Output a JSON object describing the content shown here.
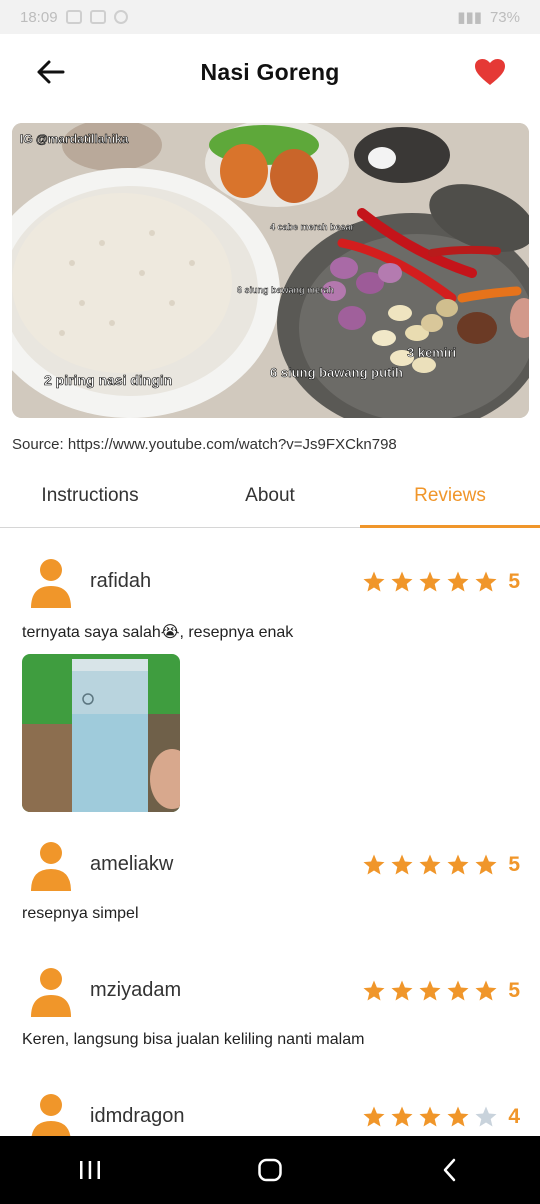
{
  "status_bar": {
    "time": "18:09",
    "battery": "73%"
  },
  "header": {
    "title": "Nasi Goreng",
    "back_icon": "arrow-left-icon",
    "favorite_icon": "heart-icon",
    "favorite_color": "#e53935"
  },
  "hero": {
    "watermark": "IG @mardatillahika",
    "labels": {
      "rice": "2 piring nasi dingin",
      "chili": "4 cabe merah besar",
      "shallot": "6 siung bawang merah",
      "garlic": "6 siung bawang putih",
      "candlenut": "3 kemiri"
    }
  },
  "source": "Source: https://www.youtube.com/watch?v=Js9FXCkn798",
  "tabs": [
    {
      "label": "Instructions",
      "active": false
    },
    {
      "label": "About",
      "active": false
    },
    {
      "label": "Reviews",
      "active": true
    }
  ],
  "accent_color": "#f0962a",
  "reviews": [
    {
      "user": "rafidah",
      "rating": 5,
      "rating_label": "5",
      "comment": "ternyata saya salah😭, resepnya enak",
      "has_photo": true
    },
    {
      "user": "ameliakw",
      "rating": 5,
      "rating_label": "5",
      "comment": "resepnya simpel",
      "has_photo": false
    },
    {
      "user": "mziyadam",
      "rating": 5,
      "rating_label": "5",
      "comment": "Keren, langsung bisa jualan keliling nanti malam",
      "has_photo": false
    },
    {
      "user": "idmdragon",
      "rating": 4,
      "rating_label": "4",
      "comment": "",
      "has_photo": false
    }
  ],
  "nav": {
    "recent_icon": "recent-apps-icon",
    "home_icon": "home-icon",
    "back_icon": "back-chevron-icon"
  }
}
